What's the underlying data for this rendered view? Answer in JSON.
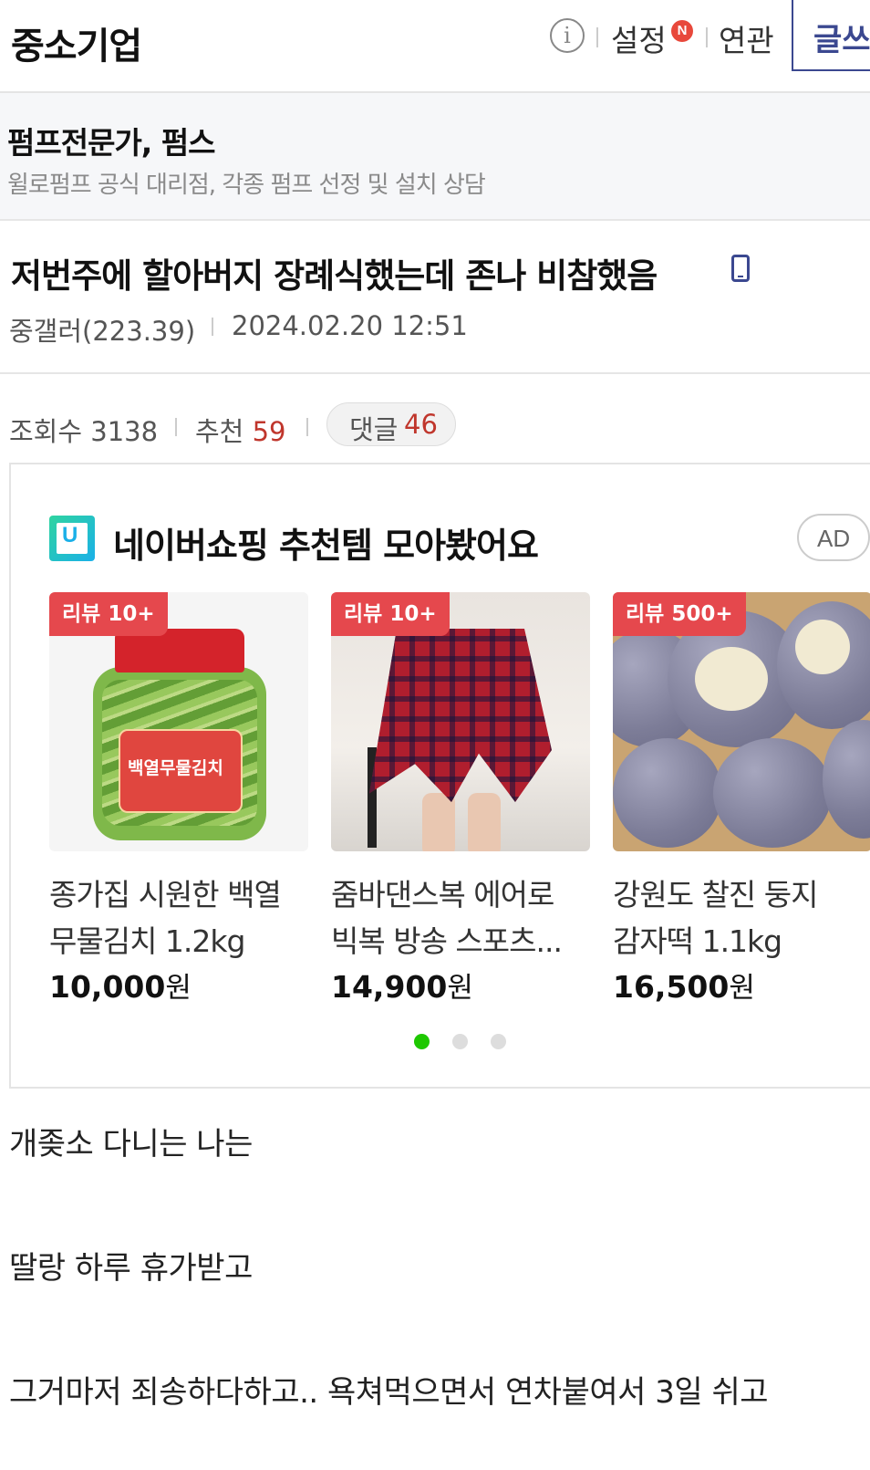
{
  "header": {
    "gallery_title": "중소기업",
    "info_icon": "info-icon",
    "settings_label": "설정",
    "settings_badge": "N",
    "related_label": "연관",
    "write_label": "글쓰기"
  },
  "banner": {
    "title": "펌프전문가, 펌스",
    "description": "윌로펌프 공식 대리점, 각종 펌프 선정 및 설치 상담"
  },
  "post": {
    "title": "저번주에 할아버지 장례식했는데 존나 비참했음",
    "device_icon": "mobile-phone-icon",
    "author": "중갤러(223.39)",
    "datetime": "2024.02.20 12:51",
    "views_label": "조회수",
    "views": "3138",
    "recommend_label": "추천",
    "recommend": "59",
    "comments_label": "댓글",
    "comments": "46"
  },
  "ad": {
    "logo_icon": "naver-shopping-logo-icon",
    "title": "네이버쇼핑 추천템 모아봤어요",
    "badge": "AD",
    "products": [
      {
        "badge": "리뷰 10+",
        "name_line1": "종가집 시원한 백열",
        "name_line2": "무물김치 1.2kg",
        "price": "10,000",
        "currency": "원",
        "image_text": "백열무물김치"
      },
      {
        "badge": "리뷰 10+",
        "name_line1": "줌바댄스복 에어로",
        "name_line2": "빅복 방송 스포츠...",
        "price": "14,900",
        "currency": "원"
      },
      {
        "badge": "리뷰 500+",
        "name_line1": "강원도 찰진 둥지",
        "name_line2": "감자떡 1.1kg",
        "price": "16,500",
        "currency": "원"
      }
    ],
    "carousel_page": 1,
    "carousel_total": 3,
    "colors": {
      "active_dot": "#1ec800",
      "badge": "#e5484d",
      "highlight_red": "#c0362c",
      "brand_navy": "#3b4890"
    }
  },
  "body": {
    "lines": [
      "개좆소 다니는 나는",
      "딸랑 하루 휴가받고",
      "그거마저 죄송하다하고.. 욕쳐먹으면서 연차붙여서 3일 쉬고"
    ]
  }
}
